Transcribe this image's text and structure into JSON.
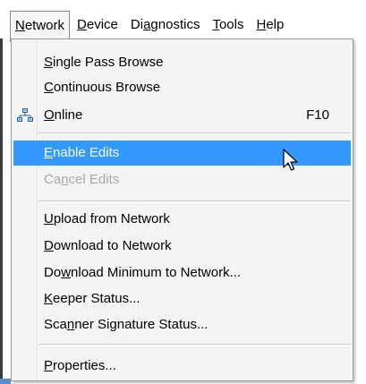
{
  "menubar": {
    "items": [
      {
        "label": "Network",
        "mnemonic": "N",
        "open": true
      },
      {
        "label": "Device",
        "mnemonic": "D"
      },
      {
        "label": "Diagnostics",
        "mnemonic": "a"
      },
      {
        "label": "Tools",
        "mnemonic": "T"
      },
      {
        "label": "Help",
        "mnemonic": "H"
      }
    ]
  },
  "dropdown": {
    "items": [
      {
        "label": "Single Pass Browse",
        "mnemonic": "S"
      },
      {
        "label": "Continuous Browse",
        "mnemonic": "C"
      },
      {
        "label": "Online",
        "mnemonic": "O",
        "shortcut": "F10",
        "icon": "network-online-icon"
      },
      {
        "label": "Enable Edits",
        "mnemonic": "E",
        "highlighted": true
      },
      {
        "label": "Cancel Edits",
        "mnemonic": "n",
        "disabled": true
      },
      {
        "label": "Upload from Network",
        "mnemonic": "U"
      },
      {
        "label": "Download to Network",
        "mnemonic": "D"
      },
      {
        "label": "Download Minimum to Network...",
        "mnemonic": "w"
      },
      {
        "label": "Keeper Status...",
        "mnemonic": "K"
      },
      {
        "label": "Scanner Signature Status...",
        "mnemonic": "n"
      },
      {
        "label": "Properties...",
        "mnemonic": "P"
      }
    ]
  },
  "colors": {
    "highlight": "#3399ff",
    "disabled_text": "#a8a8a8",
    "menu_bg": "#f4f4f4"
  }
}
